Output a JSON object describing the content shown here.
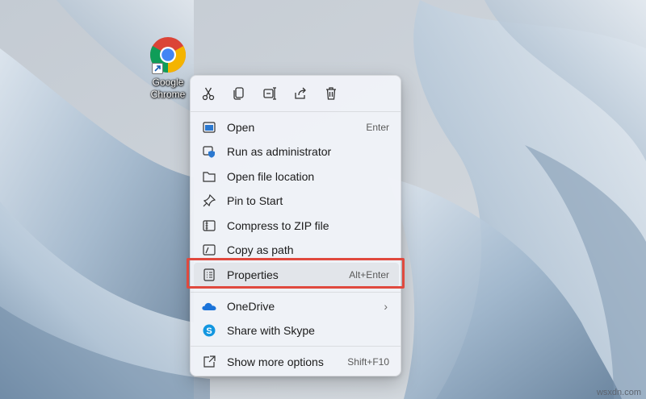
{
  "desktop": {
    "shortcut_label": "Google Chrome",
    "watermark": "wsxdn.com"
  },
  "context_menu": {
    "toolbar": [
      {
        "icon": "cut-icon",
        "name": "cut-button"
      },
      {
        "icon": "copy-icon",
        "name": "copy-button"
      },
      {
        "icon": "rename-icon",
        "name": "rename-button"
      },
      {
        "icon": "share-icon",
        "name": "share-button"
      },
      {
        "icon": "delete-icon",
        "name": "delete-button"
      }
    ],
    "items": [
      {
        "label": "Open",
        "shortcut": "Enter",
        "icon": "open-app-icon"
      },
      {
        "label": "Run as administrator",
        "shortcut": "",
        "icon": "shield-icon"
      },
      {
        "label": "Open file location",
        "shortcut": "",
        "icon": "folder-icon"
      },
      {
        "label": "Pin to Start",
        "shortcut": "",
        "icon": "pin-icon"
      },
      {
        "label": "Compress to ZIP file",
        "shortcut": "",
        "icon": "zip-icon"
      },
      {
        "label": "Copy as path",
        "shortcut": "",
        "icon": "copy-path-icon"
      },
      {
        "label": "Properties",
        "shortcut": "Alt+Enter",
        "icon": "properties-icon"
      },
      {
        "label": "OneDrive",
        "shortcut": "",
        "icon": "onedrive-icon"
      },
      {
        "label": "Share with Skype",
        "shortcut": "",
        "icon": "skype-icon"
      },
      {
        "label": "Show more options",
        "shortcut": "Shift+F10",
        "icon": "more-options-icon"
      }
    ],
    "highlight_color": "#e0493e"
  }
}
